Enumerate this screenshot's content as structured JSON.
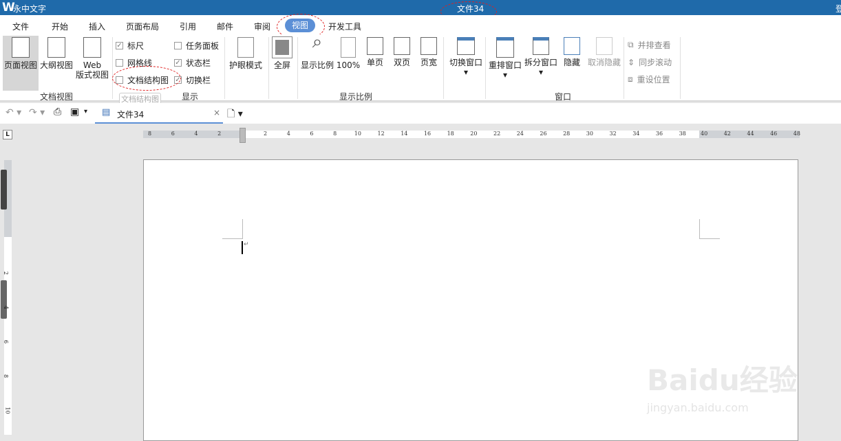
{
  "titlebar": {
    "app_name": "永中文字",
    "doc_title": "文件34",
    "login": "登"
  },
  "menu": {
    "tabs": [
      "文件",
      "开始",
      "插入",
      "页面布局",
      "引用",
      "邮件",
      "审阅",
      "视图",
      "开发工具"
    ],
    "active": "视图"
  },
  "ribbon": {
    "doc_view": {
      "group": "文档视图",
      "page_view": "页面视图",
      "outline_view": "大纲视图",
      "web_view_1": "Web",
      "web_view_2": "版式视图"
    },
    "show": {
      "group": "显示",
      "ruler": {
        "label": "标尺",
        "checked": true
      },
      "grid": {
        "label": "网格线",
        "checked": false
      },
      "docmap": {
        "label": "文档结构图",
        "checked": false
      },
      "taskpane": {
        "label": "任务面板",
        "checked": false
      },
      "statusbar": {
        "label": "状态栏",
        "checked": true
      },
      "switchbar": {
        "label": "切换栏",
        "checked": true
      },
      "tooltip": "文档结构图"
    },
    "eye": "护眼模式",
    "zoom": {
      "group": "显示比例",
      "fullscreen": "全屏",
      "zoom": "显示比例",
      "percent": "100%",
      "single": "单页",
      "double": "双页",
      "width": "页宽"
    },
    "window": {
      "group": "窗口",
      "switch": "切换窗口",
      "arrange": "重排窗口",
      "split": "拆分窗口",
      "hide": "隐藏",
      "unhide": "取消隐藏",
      "side": "并排查看",
      "sync": "同步滚动",
      "reset": "重设位置"
    }
  },
  "toolbar": {
    "doc_tab": "文件34"
  },
  "ruler": {
    "left": [
      "8",
      "6",
      "4",
      "2"
    ],
    "main": [
      "2",
      "4",
      "6",
      "8",
      "10",
      "12",
      "14",
      "16",
      "18",
      "20",
      "22",
      "24",
      "26",
      "28",
      "30",
      "32",
      "34",
      "36",
      "38"
    ],
    "right": [
      "40",
      "42",
      "44",
      "46",
      "48"
    ],
    "vertical": [
      "2",
      "4",
      "6",
      "8",
      "10"
    ],
    "corner": "L"
  },
  "watermark": {
    "text": "Baidu经验",
    "url": "jingyan.baidu.com"
  },
  "colors": {
    "title_bar": "#1f6aaa",
    "active_tab": "#5b8fd6",
    "annotation": "#e02020"
  }
}
